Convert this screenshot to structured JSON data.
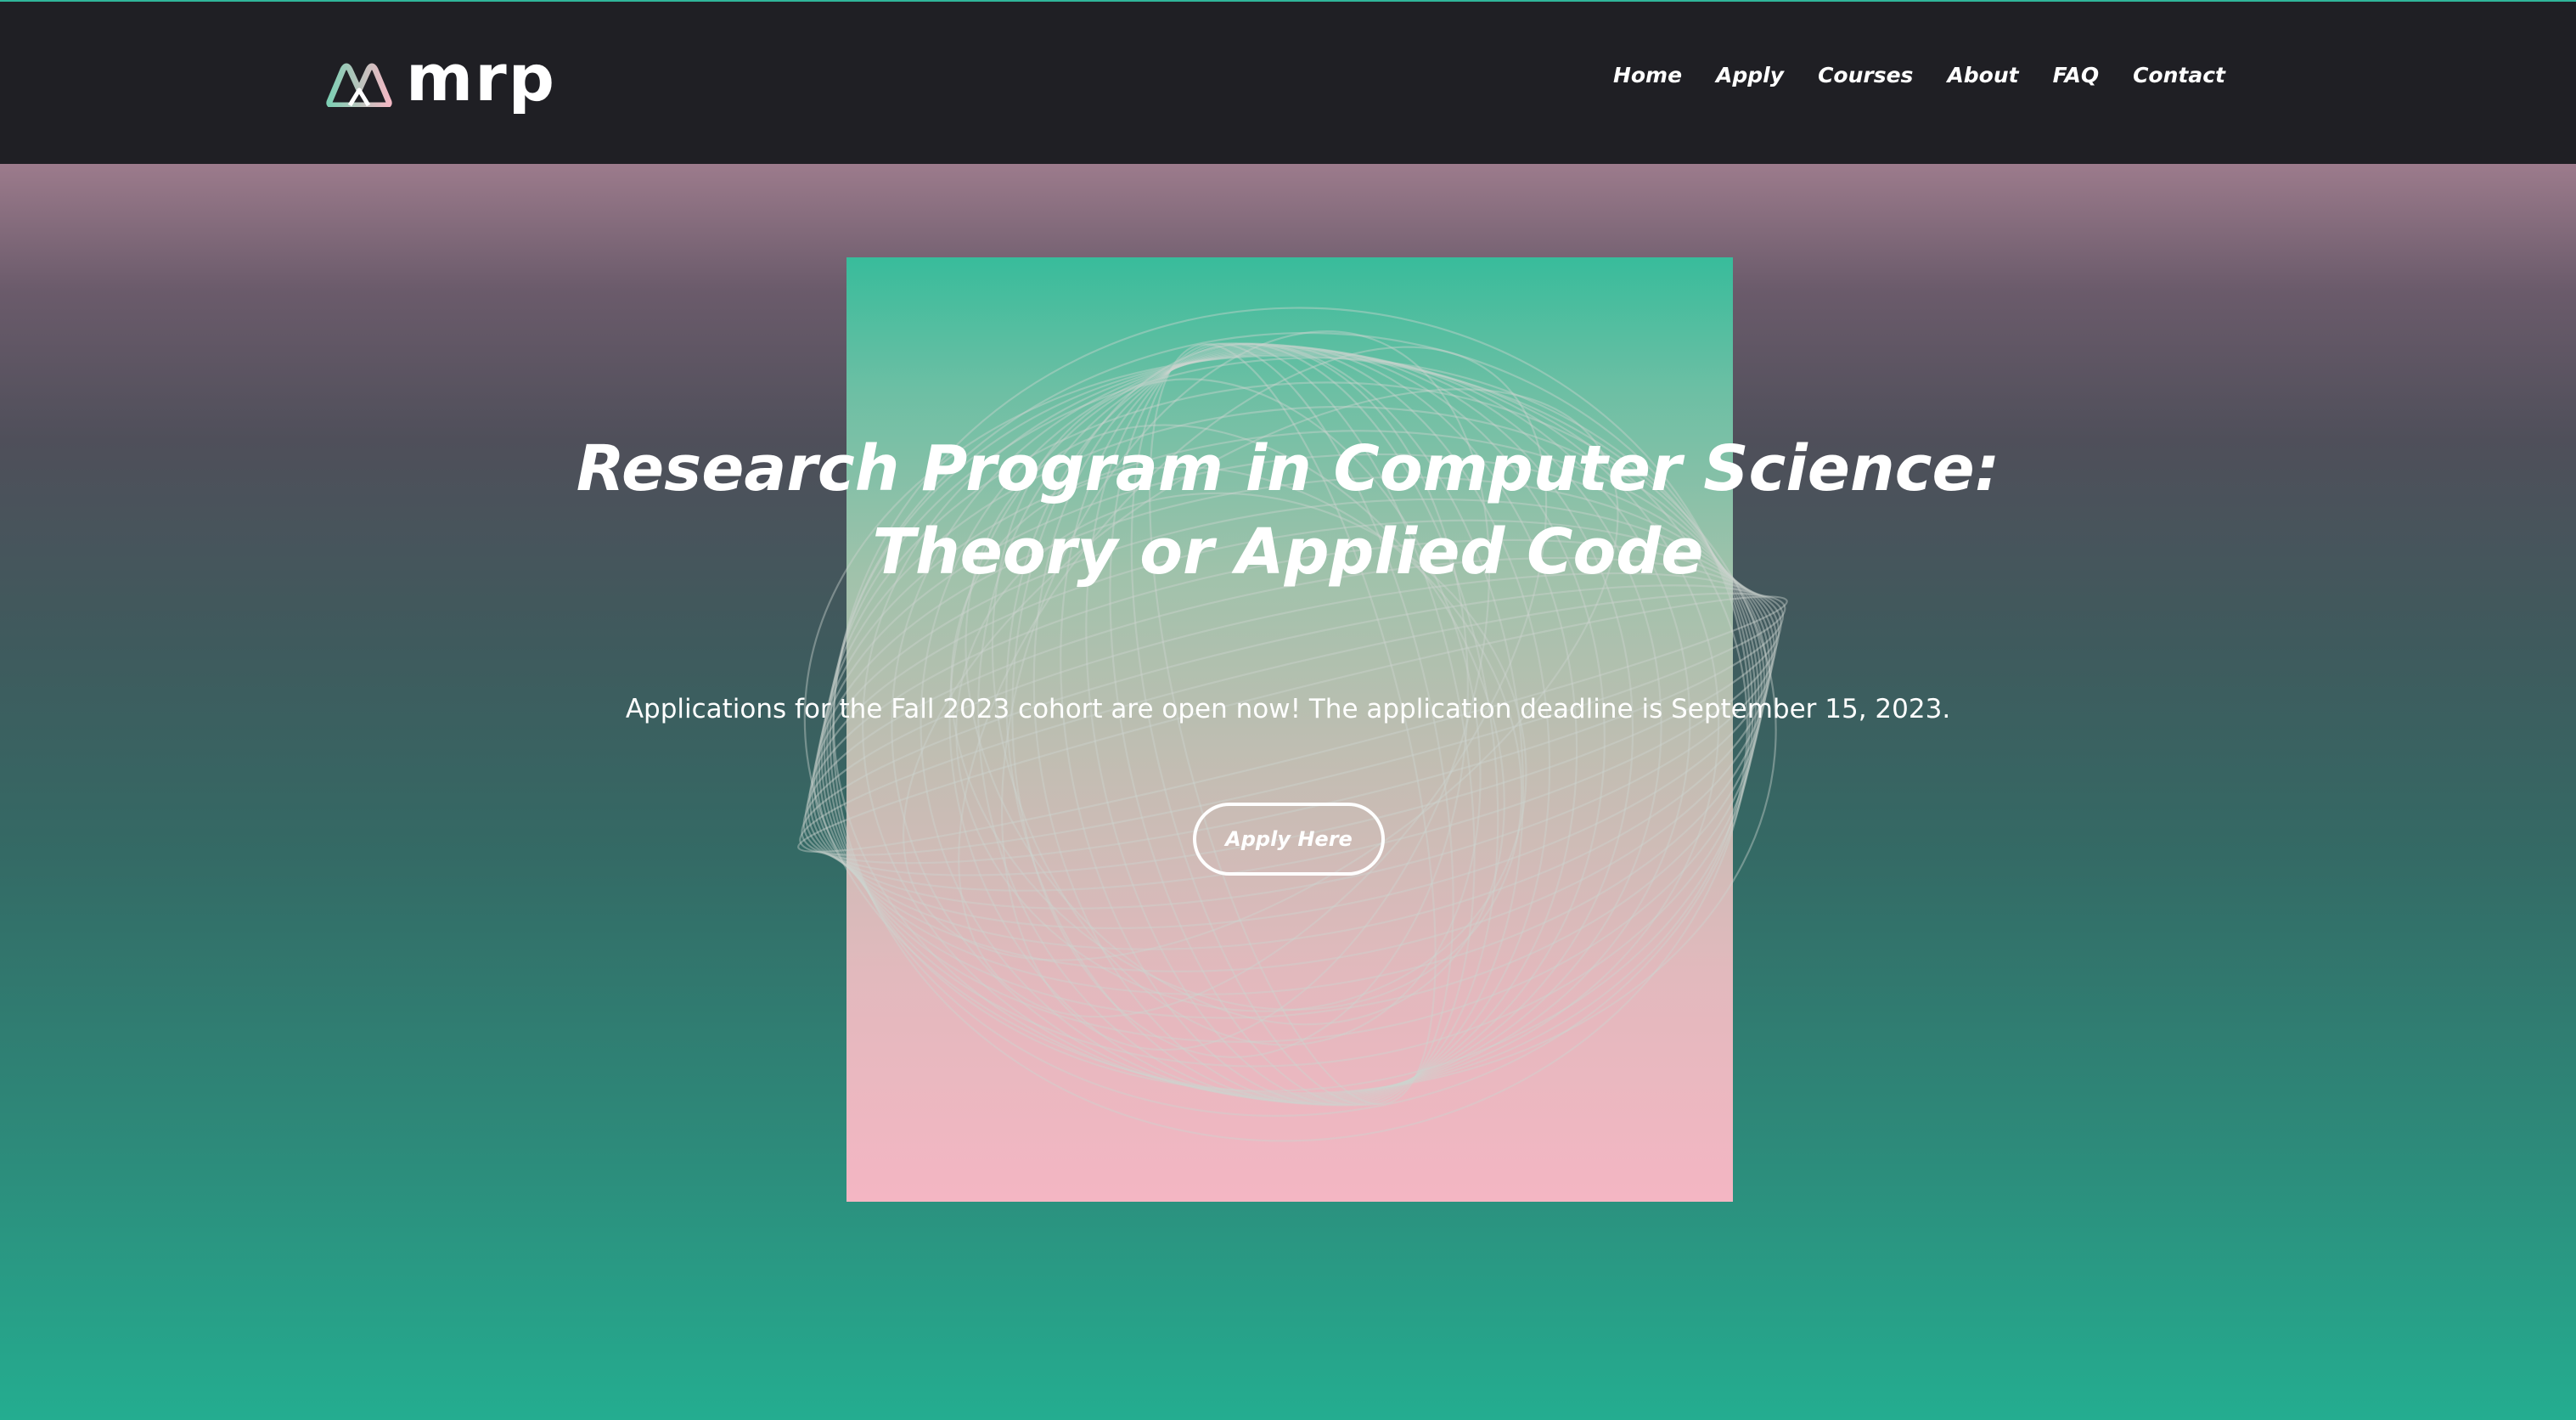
{
  "brand": {
    "logo_icon": "mountain-peaks-logo-icon",
    "name": "mrp"
  },
  "nav": {
    "items": [
      {
        "label": "Home"
      },
      {
        "label": "Apply"
      },
      {
        "label": "Courses"
      },
      {
        "label": "About"
      },
      {
        "label": "FAQ"
      },
      {
        "label": "Contact"
      }
    ]
  },
  "hero": {
    "title_line1": "Research Program in Computer Science:",
    "title_line2": "Theory or Applied Code",
    "subtitle": "Applications for the Fall 2023 cohort are open now! The application deadline is September 15, 2023.",
    "cta_label": "Apply Here",
    "artwork_icon": "wireframe-sphere-graphic"
  },
  "colors": {
    "navbar_bg": "#1f1f24",
    "accent_teal": "#2fb59a",
    "accent_pink": "#f4b6c3",
    "text": "#ffffff"
  }
}
